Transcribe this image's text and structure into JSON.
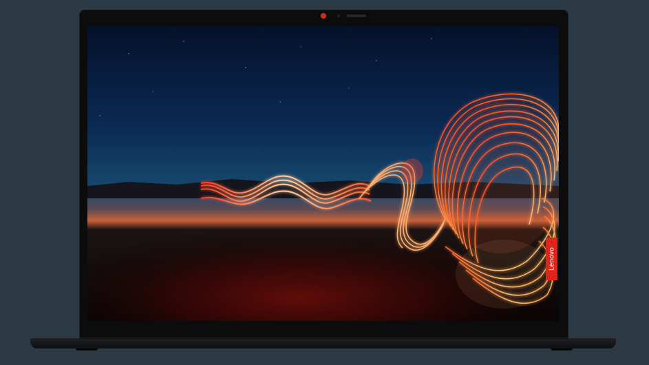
{
  "device": {
    "brand_label": "Lenovo",
    "colors": {
      "background": "#2c3a45",
      "bezel": "#0c0c0d",
      "brand_tag": "#e2231a",
      "camera": "#c2331f"
    }
  },
  "wallpaper": {
    "description_icon": "light-painting-wallpaper",
    "colors": {
      "sky_top": "#05112a",
      "sky_mid": "#0f3a66",
      "horizon": "#c8613a",
      "ground": "#2a0604",
      "ribbon": "#ff5a2a",
      "ribbon_glow": "#ffc070"
    }
  }
}
